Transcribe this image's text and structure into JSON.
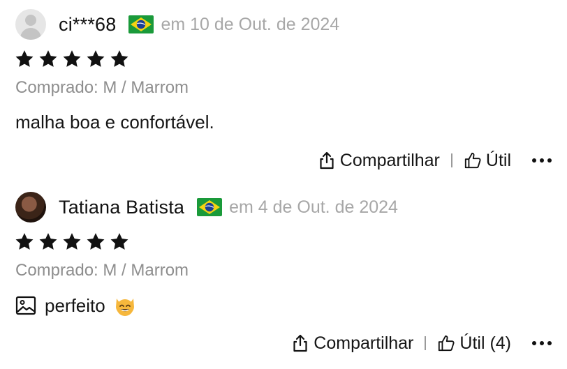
{
  "reviews": [
    {
      "user": "ci***68",
      "country_flag": "brazil-flag",
      "date": "em 10 de Out. de 2024",
      "rating": 5,
      "variant": "Comprado: M / Marrom",
      "text": "malha boa e confortável.",
      "has_image": false,
      "emoji": "",
      "actions": {
        "share": "Compartilhar",
        "helpful": "Útil"
      }
    },
    {
      "user": "Tatiana Batista",
      "country_flag": "brazil-flag",
      "date": "em 4 de Out. de 2024",
      "rating": 5,
      "variant": "Comprado: M / Marrom",
      "text": "perfeito",
      "has_image": true,
      "emoji": "smiling-cat-emoji",
      "actions": {
        "share": "Compartilhar",
        "helpful": "Útil (4)"
      }
    }
  ],
  "colors": {
    "flag_green": "#1a9a3a",
    "flag_yellow": "#f4d312",
    "flag_blue": "#1b3f94",
    "muted_text": "#a7a7a7"
  },
  "icons": [
    "avatar-placeholder-icon",
    "star-icon",
    "share-icon",
    "thumbs-up-icon",
    "more-icon",
    "image-icon"
  ]
}
